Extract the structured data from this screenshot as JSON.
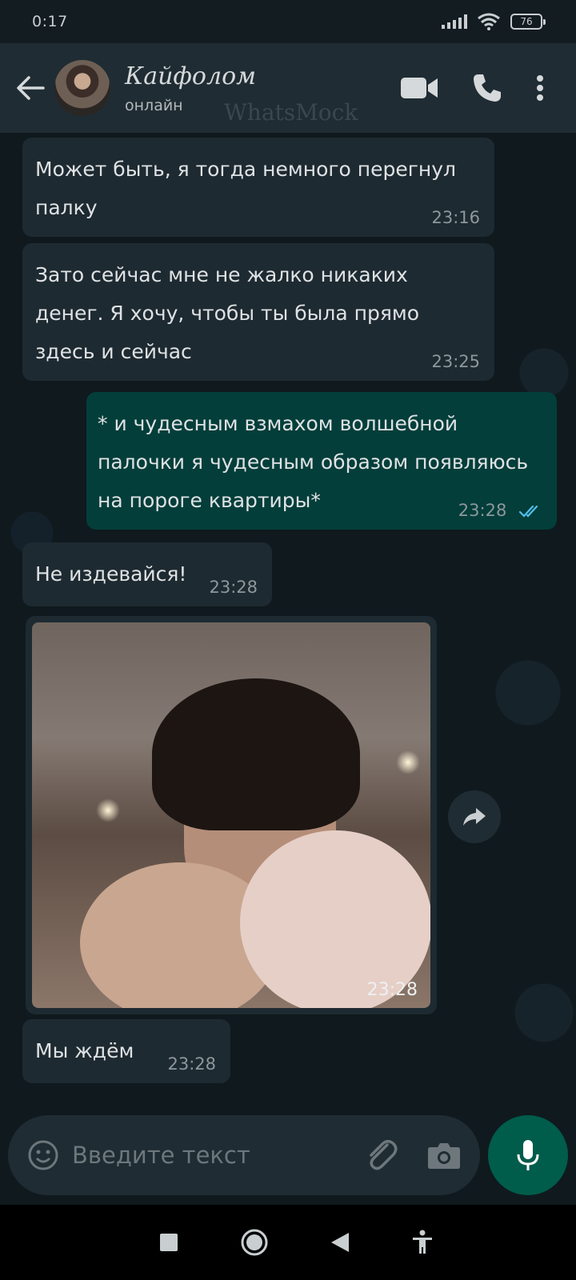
{
  "status_bar": {
    "time": "0:17",
    "battery": "76"
  },
  "header": {
    "contact_name": "Кайфолом",
    "contact_status": "онлайн",
    "watermark": "WhatsMock"
  },
  "messages": [
    {
      "direction": "incoming",
      "text": "Может быть, я тогда немного перегнул палку",
      "time": "23:16"
    },
    {
      "direction": "incoming",
      "text": "Зато сейчас мне не жалко никаких денег. Я хочу, чтобы ты была прямо здесь и сейчас",
      "time": "23:25"
    },
    {
      "direction": "outgoing",
      "text": "* и чудесным взмахом волшебной палочки я чудесным образом появляюсь на пороге квартиры*",
      "time": "23:28",
      "status": "read"
    },
    {
      "direction": "incoming",
      "text": "Не издевайся!",
      "time": "23:28"
    },
    {
      "direction": "incoming",
      "type": "image",
      "time": "23:28"
    },
    {
      "direction": "incoming",
      "text": "Мы ждём",
      "time": "23:28"
    }
  ],
  "composer": {
    "placeholder": "Введите текст"
  },
  "colors": {
    "header_bg": "#1f2c33",
    "incoming_bubble": "#1e2a31",
    "outgoing_bubble": "#033e3a",
    "read_ticks": "#53bdeb",
    "mic_button": "#005c4b"
  },
  "icons": {
    "back": "arrow-left-icon",
    "video": "video-call-icon",
    "call": "phone-icon",
    "menu": "more-vertical-icon",
    "emoji": "emoji-icon",
    "attach": "paperclip-icon",
    "camera": "camera-icon",
    "mic": "mic-icon",
    "forward": "forward-icon"
  }
}
